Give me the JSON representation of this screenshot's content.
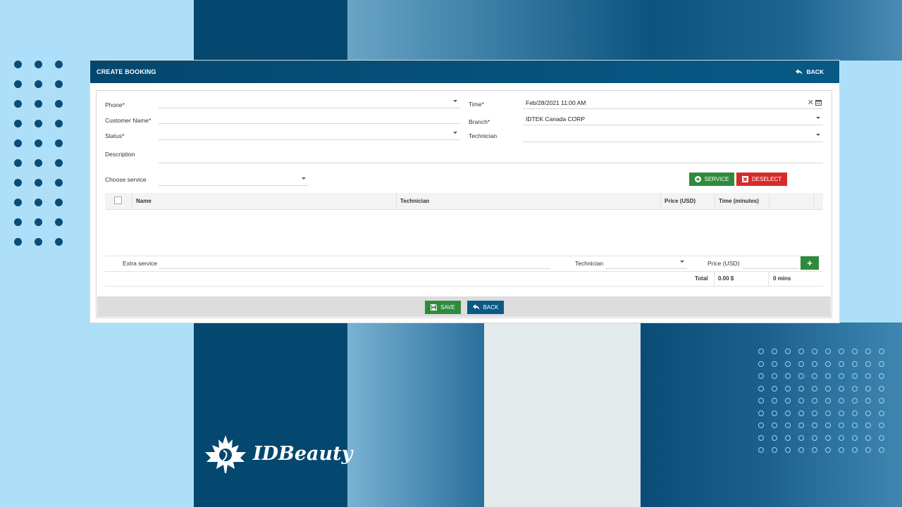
{
  "dialog": {
    "title": "CREATE BOOKING",
    "header_back_label": "BACK"
  },
  "form": {
    "phone_label": "Phone*",
    "phone_value": "",
    "customer_name_label": "Customer Name*",
    "customer_name_value": "",
    "status_label": "Status*",
    "status_value": "",
    "description_label": "Description",
    "description_value": "",
    "time_label": "Time*",
    "time_value": "Feb/28/2021 11:00 AM",
    "branch_label": "Branch*",
    "branch_value": "IDTEK Canada CORP",
    "technician_label": "Technician",
    "technician_value": "",
    "choose_service_label": "Choose service",
    "choose_service_value": ""
  },
  "buttons": {
    "service_label": "SERVICE",
    "deselect_label": "DESELECT",
    "save_label": "SAVE",
    "back_label": "BACK",
    "add_extra_label": "+"
  },
  "table": {
    "columns": [
      "Name",
      "Technician",
      "Price (USD)",
      "Time (minutes)"
    ],
    "rows": []
  },
  "extra": {
    "extra_service_label": "Extra service",
    "technician_label": "Technician",
    "price_label": "Price (USD)"
  },
  "totals": {
    "total_label": "Total",
    "price_total": "0.00 $",
    "time_total": "0 mins"
  },
  "branding": {
    "logo_text": "IDBeauty"
  },
  "colors": {
    "header": "#04476f",
    "green": "#2e8b3c",
    "red": "#d62b2b",
    "blue": "#0a5a84"
  }
}
